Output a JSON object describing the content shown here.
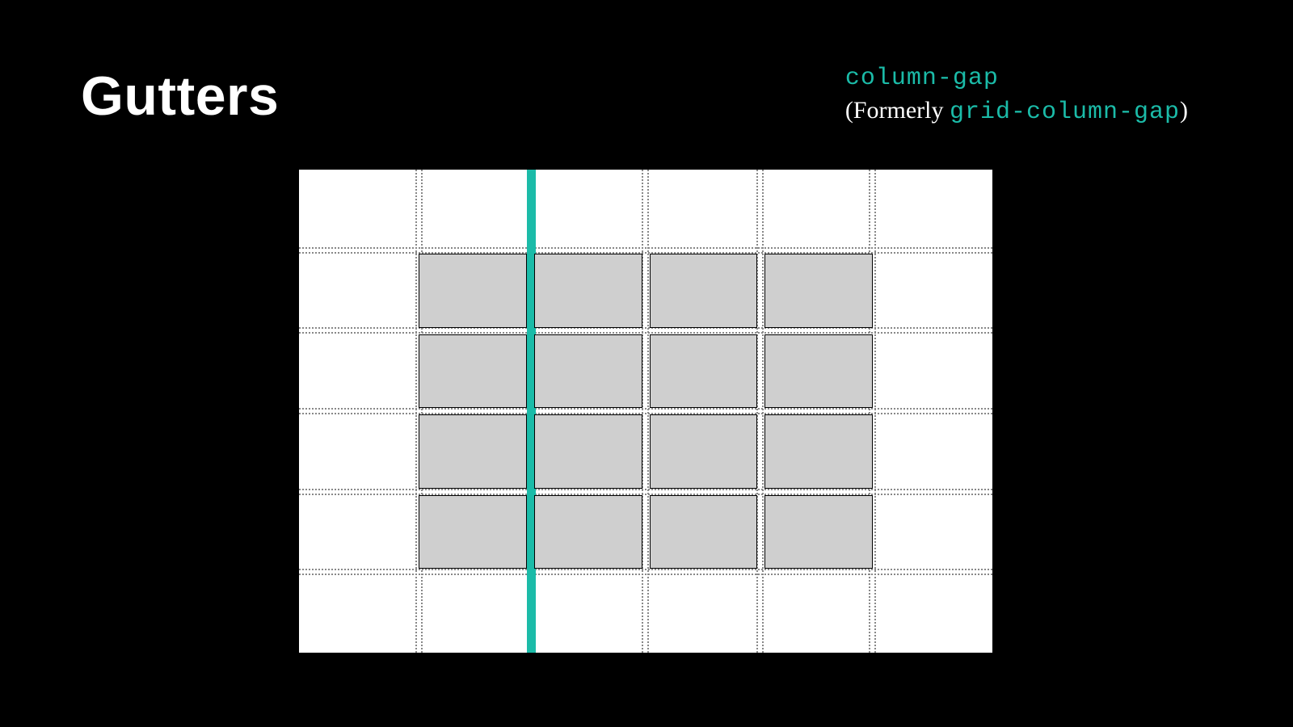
{
  "title": "Gutters",
  "code": {
    "property": "column-gap",
    "formerly_prefix": "(Formerly ",
    "formerly_property": "grid-column-gap",
    "formerly_suffix": ")"
  },
  "accent_color": "#1bbba8",
  "diagram": {
    "grid_columns": 4,
    "grid_rows": 4,
    "highlighted_gutter_index": 1,
    "description": "A 4x4 grid of grey cells on a white panel with dashed track guide lines. One vertical column gutter is highlighted in teal to illustrate the column-gap property."
  }
}
